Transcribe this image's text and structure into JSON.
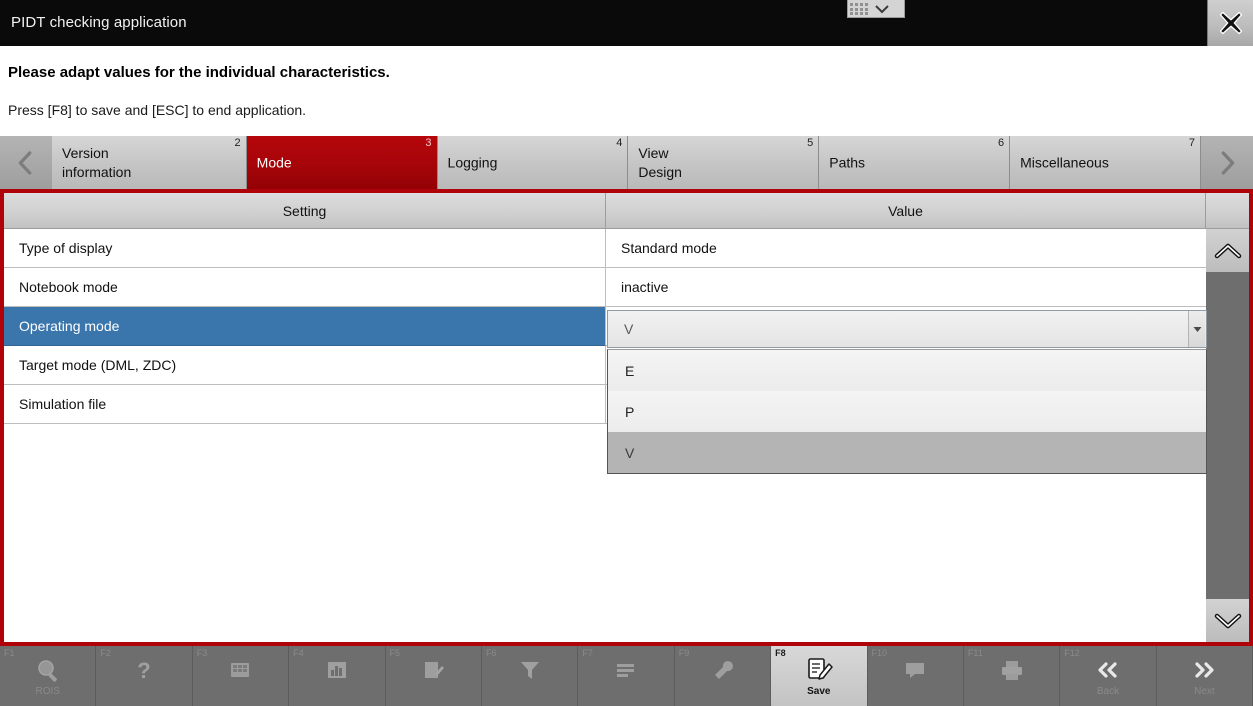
{
  "window": {
    "title": "PIDT checking application",
    "close_icon": "close-icon"
  },
  "mini_widget": {
    "grid_icon": "grid-handle-icon",
    "chevron_icon": "chevron-down-icon"
  },
  "instructions": {
    "line1": "Please adapt values for the individual characteristics.",
    "line2": "Press [F8] to save and [ESC] to end application."
  },
  "tabs": {
    "prev_icon": "chevron-left-icon",
    "next_icon": "chevron-right-icon",
    "items": [
      {
        "label": "Version\ninformation",
        "number": "2",
        "active": false
      },
      {
        "label": "Mode",
        "number": "3",
        "active": true
      },
      {
        "label": "Logging",
        "number": "4",
        "active": false
      },
      {
        "label": "View\nDesign",
        "number": "5",
        "active": false
      },
      {
        "label": "Paths",
        "number": "6",
        "active": false
      },
      {
        "label": "Miscellaneous",
        "number": "7",
        "active": false
      }
    ]
  },
  "table": {
    "headers": {
      "setting": "Setting",
      "value": "Value"
    },
    "rows": [
      {
        "setting": "Type of display",
        "value": "Standard mode",
        "selected": false
      },
      {
        "setting": "Notebook mode",
        "value": "inactive",
        "selected": false
      },
      {
        "setting": "Operating mode",
        "value": "V",
        "selected": true
      },
      {
        "setting": "Target mode (DML, ZDC)",
        "value": "",
        "selected": false
      },
      {
        "setting": "Simulation file",
        "value": "",
        "selected": false
      }
    ]
  },
  "combo": {
    "value": "V",
    "arrow_icon": "dropdown-arrow-icon",
    "options": [
      {
        "label": "E",
        "highlighted": false
      },
      {
        "label": "P",
        "highlighted": false
      },
      {
        "label": "V",
        "highlighted": true
      }
    ]
  },
  "scroll": {
    "up_icon": "chevron-up-icon",
    "down_icon": "chevron-down-icon"
  },
  "toolbar": {
    "buttons": [
      {
        "fkey": "F1",
        "label": "ROIS",
        "icon": "magnifier-icon",
        "enabled": false
      },
      {
        "fkey": "F2",
        "label": "",
        "icon": "help-icon",
        "enabled": false
      },
      {
        "fkey": "F3",
        "label": "",
        "icon": "keypad-icon",
        "enabled": false
      },
      {
        "fkey": "F4",
        "label": "",
        "icon": "bar-chart-icon",
        "enabled": false
      },
      {
        "fkey": "F5",
        "label": "",
        "icon": "note-edit-icon",
        "enabled": false
      },
      {
        "fkey": "F6",
        "label": "",
        "icon": "funnel-icon",
        "enabled": false
      },
      {
        "fkey": "F7",
        "label": "",
        "icon": "list-icon",
        "enabled": false
      },
      {
        "fkey": "F9",
        "label": "",
        "icon": "wrench-icon",
        "enabled": false
      },
      {
        "fkey": "F8",
        "label": "Save",
        "icon": "save-icon",
        "enabled": true
      },
      {
        "fkey": "F10",
        "label": "",
        "icon": "comment-icon",
        "enabled": false
      },
      {
        "fkey": "F11",
        "label": "",
        "icon": "printer-icon",
        "enabled": false
      },
      {
        "fkey": "F12",
        "label": "Back",
        "icon": "double-left-icon",
        "enabled": false
      },
      {
        "fkey": "",
        "label": "Next",
        "icon": "double-right-icon",
        "enabled": false
      }
    ]
  },
  "colors": {
    "accent_red": "#b00309",
    "active_tab_red": "#a60509",
    "selected_row_blue": "#3a75ab",
    "toolbar_gray": "#6e6e6e",
    "titlebar_black": "#0a0a0a"
  }
}
